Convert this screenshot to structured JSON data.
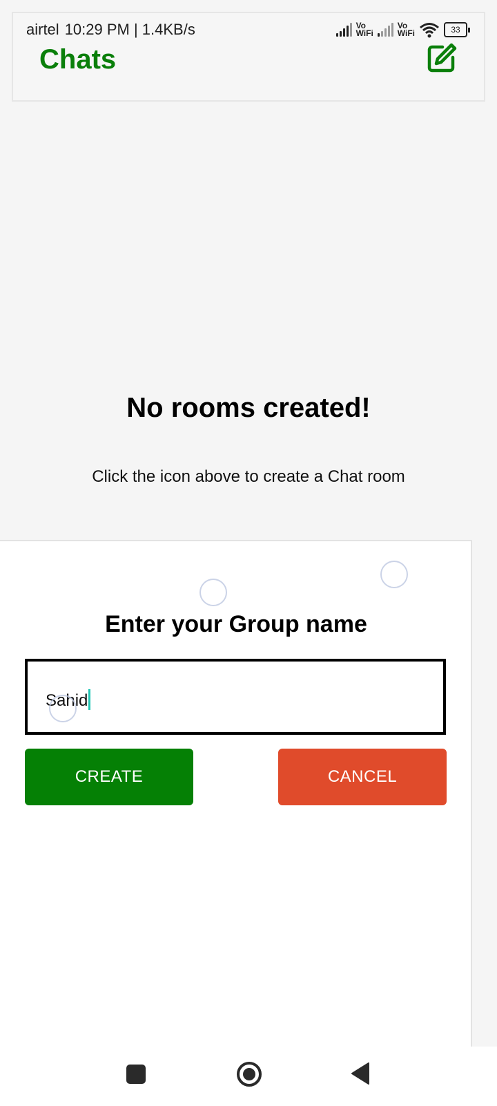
{
  "status_bar": {
    "carrier": "airtel",
    "time_speed": "10:29 PM | 1.4KB/s",
    "sim1_label_top": "Vo",
    "sim1_label_bottom": "WiFi",
    "sim2_label_top": "Vo",
    "sim2_label_bottom": "WiFi",
    "battery": "33",
    "icons": [
      "signal-icon",
      "signal-icon",
      "wifi-icon",
      "battery-icon"
    ]
  },
  "header": {
    "title": "Chats",
    "compose_icon": "edit-icon",
    "accent": "#0a7f0a"
  },
  "empty_state": {
    "title": "No rooms created!",
    "subtitle": "Click the icon above to create a Chat room"
  },
  "dialog": {
    "title": "Enter your Group name",
    "input_value": "Sahid",
    "create_label": "CREATE",
    "cancel_label": "CANCEL",
    "create_color": "#058005",
    "cancel_color": "#e04b2b"
  },
  "nav_bar": {
    "icons": [
      "recents-icon",
      "home-icon",
      "back-icon"
    ]
  }
}
